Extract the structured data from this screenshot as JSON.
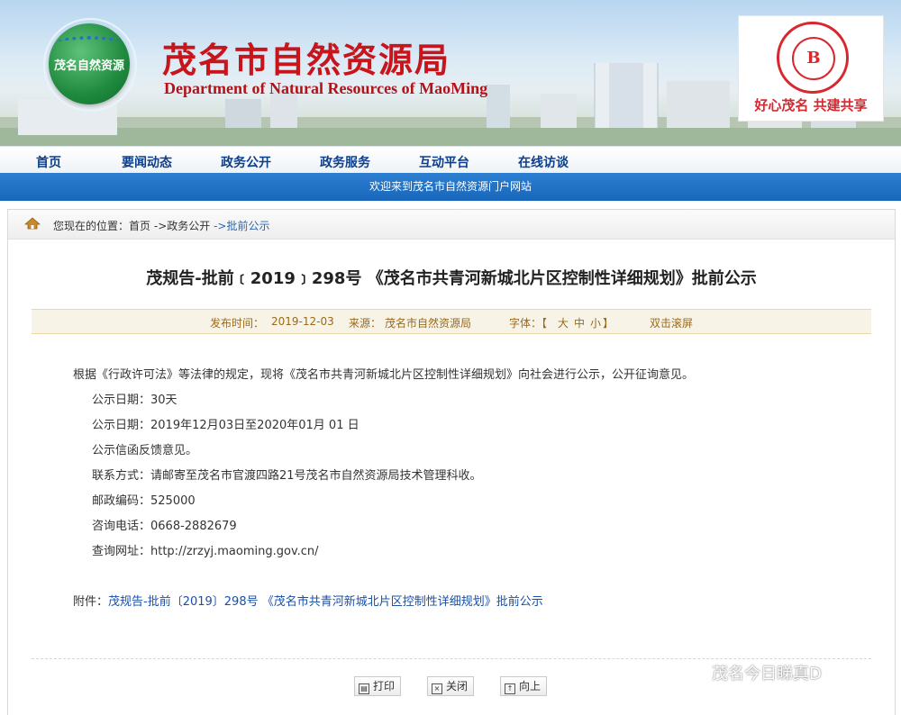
{
  "header": {
    "logo_text": "茂名自然资源",
    "title": "茂名市自然资源局",
    "subtitle": "Department of Natural Resources of MaoMing",
    "promo_slogan": "好心茂名 共建共享"
  },
  "nav": {
    "items": [
      "首页",
      "要闻动态",
      "政务公开",
      "政务服务",
      "互动平台",
      "在线访谈"
    ]
  },
  "welcome": "欢迎来到茂名市自然资源门户网站",
  "breadcrumb": {
    "prefix": "您现在的位置：",
    "items": [
      "首页",
      "->政务公开",
      "->批前公示"
    ]
  },
  "article": {
    "title": "茂规告-批前﹝2019﹞298号 《茂名市共青河新城北片区控制性详细规划》批前公示",
    "meta": {
      "date_label": "发布时间：",
      "date": "2019-12-03",
      "source_label": "来源：",
      "source": "茂名市自然资源局",
      "font_label": "字体：【",
      "font_large": "大",
      "font_medium": "中",
      "font_small": "小",
      "font_close": "】",
      "scroll": "双击滚屏"
    },
    "paragraphs": [
      "根据《行政许可法》等法律的规定，现将《茂名市共青河新城北片区控制性详细规划》向社会进行公示，公开征询意见。",
      "公示日期：30天",
      "公示日期：2019年12月03日至2020年01月 01 日",
      "公示信函反馈意见。",
      "联系方式：请邮寄至茂名市官渡四路21号茂名市自然资源局技术管理科收。",
      "邮政编码：525000",
      "咨询电话：0668-2882679",
      "查询网址：http://zrzyj.maoming.gov.cn/"
    ],
    "attachment_label": "附件：",
    "attachment_link": "茂规告-批前〔2019〕298号 《茂名市共青河新城北片区控制性详细规划》批前公示"
  },
  "actions": {
    "print": "打印",
    "close": "关闭",
    "top": "向上"
  },
  "watermark": "茂名今日睇真D",
  "colors": {
    "title_red": "#c8141b",
    "nav_blue": "#0b3f8c",
    "welcome_bar": "#1766bb",
    "meta_bg": "#f7f3e6",
    "link_blue": "#1a4fa6"
  }
}
